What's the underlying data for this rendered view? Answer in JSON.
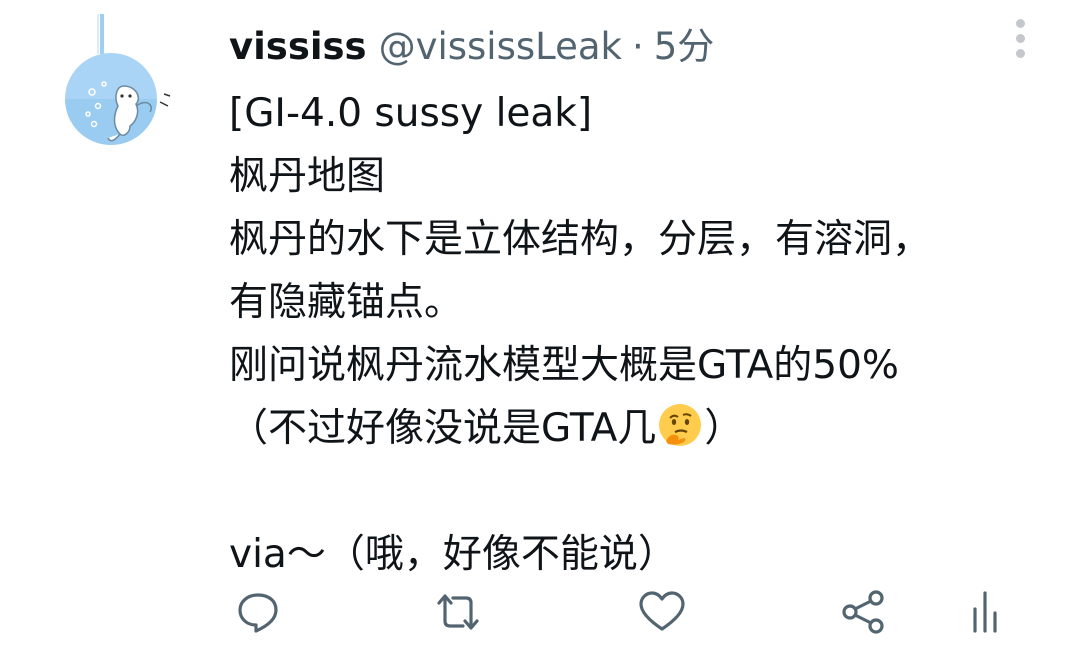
{
  "tweet": {
    "display_name": "vississ",
    "handle": "@vississLeak",
    "separator": "·",
    "timestamp": "5分",
    "lines": [
      "[GI-4.0 sussy leak]",
      "枫丹地图",
      "枫丹的水下是立体结构，分层，有溶洞，",
      "有隐藏锚点。",
      "刚问说枫丹流水模型大概是GTA的50%",
      "（不过好像没说是GTA几",
      "",
      "via～（哦，好像不能说）"
    ],
    "line6_suffix": "）",
    "emoji": "thinking-face"
  },
  "actions": {
    "reply_icon": "reply-icon",
    "retweet_icon": "retweet-icon",
    "like_icon": "like-icon",
    "share_icon": "share-icon",
    "analytics_icon": "analytics-icon"
  },
  "colors": {
    "text": "#0f1419",
    "secondary": "#536471",
    "icon": "#536471",
    "avatar_bg": "#a9d4f5"
  }
}
